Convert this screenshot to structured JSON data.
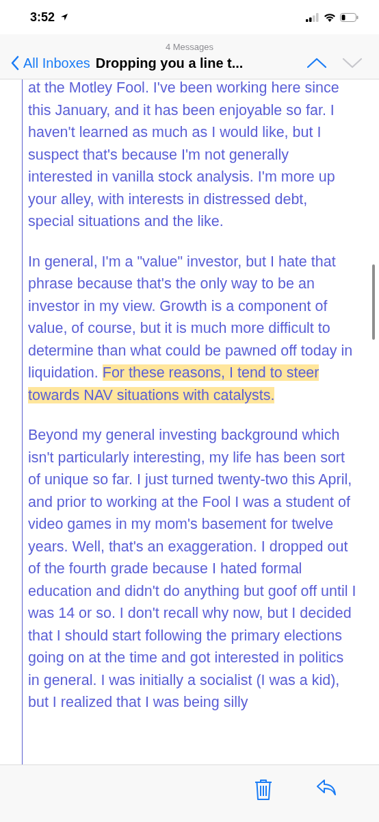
{
  "status_bar": {
    "time": "3:52"
  },
  "nav": {
    "count": "4 Messages",
    "back": "All Inboxes",
    "title": "Dropping you a line t...",
    "prev_disabled": false,
    "next_disabled": true
  },
  "body": {
    "paragraphs": [
      {
        "segments": [
          {
            "text": "at the Motley Fool. I've been working here since this January, and it has been enjoyable so far. I haven't learned as much as I would like, but I suspect that's because I'm not generally interested in vanilla stock analysis. I'm more up your alley, with interests in distressed debt, special situations and the like.",
            "highlighted": false
          }
        ]
      },
      {
        "segments": [
          {
            "text": " In general, I'm a \"value\" investor, but I hate that phrase because that's the only way to be an investor in my view. Growth is a component of value, of course, but it is much more difficult to determine than what could be pawned off today in liquidation. ",
            "highlighted": false
          },
          {
            "text": "For these reasons, I tend to steer towards NAV situations with catalysts.",
            "highlighted": true
          }
        ]
      },
      {
        "segments": [
          {
            "text": "Beyond my general investing background which isn't particularly interesting, my life has been sort of unique so far. I just turned twenty-two this April, and prior to working at the Fool I was a student of video games in my mom's basement for twelve years. Well, that's an exaggeration. I dropped out of the fourth grade because I hated formal education and didn't do anything but goof off until I was 14 or so. I don't recall why now, but I decided that I should start following the primary elections going on at the time and got interested in politics in general. I was initially a socialist (I was a kid), but I realized that I was being silly",
            "highlighted": false
          }
        ]
      }
    ]
  }
}
